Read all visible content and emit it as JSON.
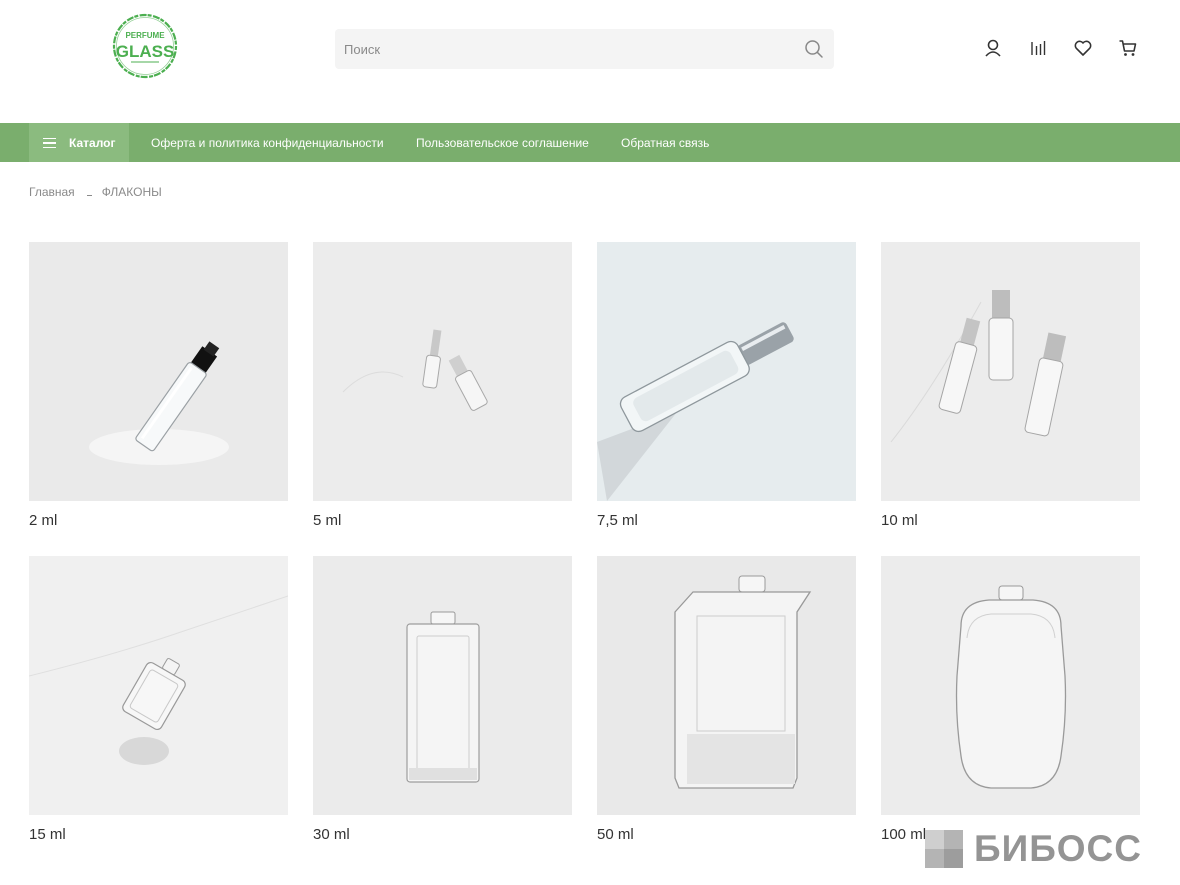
{
  "header": {
    "logo_line1": "PERFUME",
    "logo_line2": "GLASS",
    "search_placeholder": "Поиск",
    "icons": [
      "user-icon",
      "compare-icon",
      "heart-icon",
      "cart-icon"
    ]
  },
  "nav": {
    "catalog_label": "Каталог",
    "links": [
      "Оферта и политика конфиденциальности",
      "Пользовательское соглашение",
      "Обратная связь"
    ]
  },
  "breadcrumb": {
    "home": "Главная",
    "current": "ФЛАКОНЫ"
  },
  "products": [
    {
      "title": "2 ml"
    },
    {
      "title": "5 ml"
    },
    {
      "title": "7,5 ml"
    },
    {
      "title": "10 ml"
    },
    {
      "title": "15 ml"
    },
    {
      "title": "30 ml"
    },
    {
      "title": "50 ml"
    },
    {
      "title": "100 ml"
    }
  ],
  "watermark": "БИБОСС",
  "colors": {
    "brand_green": "#7aae6d",
    "catalog_green": "#8bbb7f",
    "logo_green": "#4caf50"
  }
}
